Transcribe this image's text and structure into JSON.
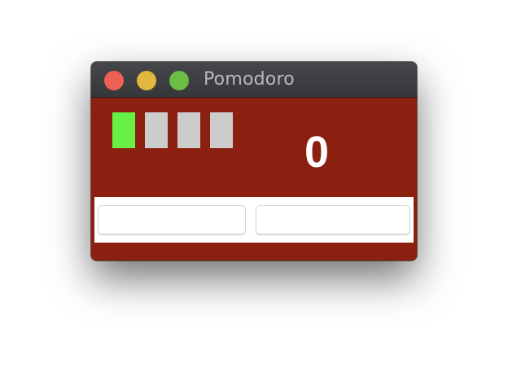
{
  "window": {
    "title": "Pomodoro",
    "controls": [
      "close",
      "minimize",
      "zoom"
    ]
  },
  "colors": {
    "background": "#8b2010",
    "tomato_active": "#67f045",
    "tomato_inactive": "#cccccc"
  },
  "tomatoes": {
    "total": 4,
    "active": 1
  },
  "counter": "0",
  "buttons": {
    "left_label": "",
    "right_label": ""
  }
}
